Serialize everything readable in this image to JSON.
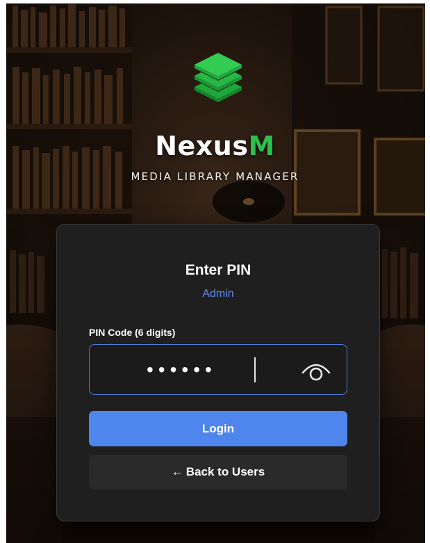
{
  "header": {
    "brand_main": "Nexus",
    "brand_accent": "M",
    "tagline": "MEDIA LIBRARY MANAGER",
    "logo_icon": "stacked-layers-icon"
  },
  "card": {
    "title": "Enter PIN",
    "user": "Admin",
    "pin_label": "PIN Code (6 digits)",
    "pin_masked": "••••••",
    "visibility_icon": "eye-icon",
    "login_label": "Login",
    "back_arrow": "←",
    "back_label": "Back to Users"
  },
  "colors": {
    "accent_green": "#2fbf4e",
    "primary_blue": "#4f86ee",
    "link_blue": "#5b8def",
    "card_bg": "#1f1f20"
  }
}
